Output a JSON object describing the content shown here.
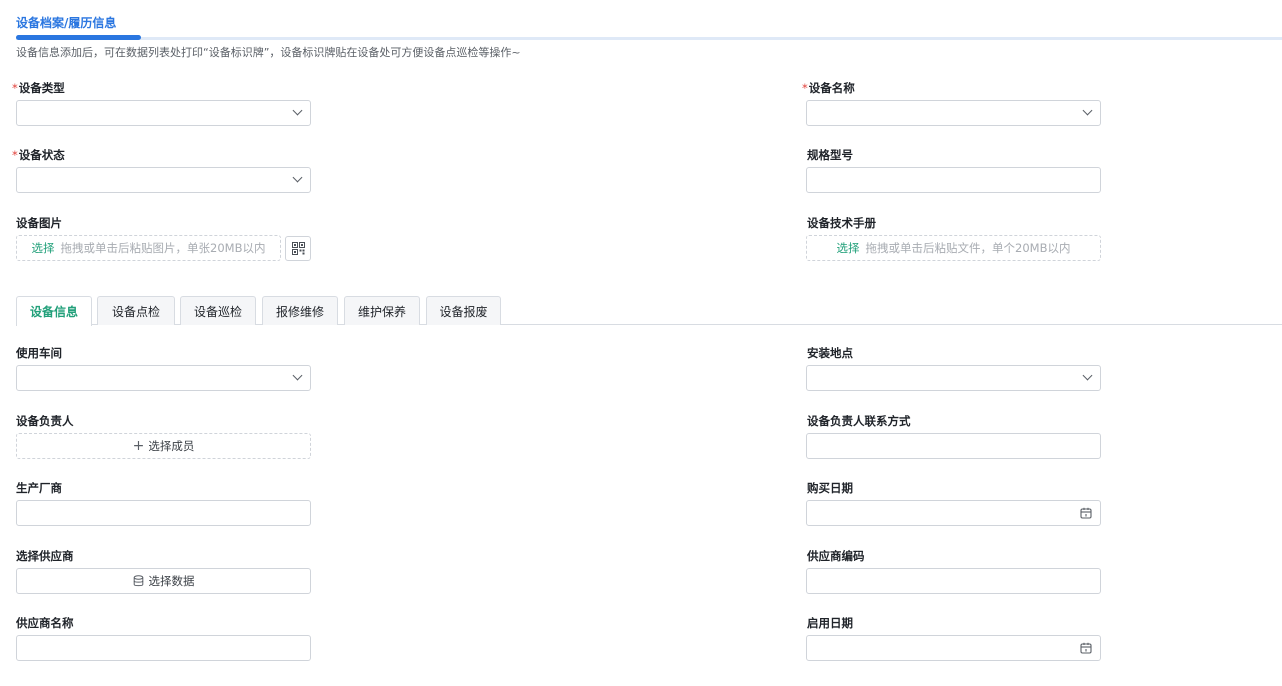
{
  "header": {
    "title": "设备档案/履历信息",
    "tip": "设备信息添加后，可在数据列表处打印“设备标识牌”，设备标识牌贴在设备处可方便设备点巡检等操作~"
  },
  "form": {
    "device_type": {
      "label": "设备类型",
      "required": "*"
    },
    "device_name": {
      "label": "设备名称",
      "required": "*"
    },
    "device_status": {
      "label": "设备状态",
      "required": "*"
    },
    "spec_model": {
      "label": "规格型号"
    },
    "device_image": {
      "label": "设备图片",
      "pick": "选择",
      "hint": "拖拽或单击后粘贴图片，单张20MB以内"
    },
    "tech_manual": {
      "label": "设备技术手册",
      "pick": "选择",
      "hint": "拖拽或单击后粘贴文件，单个20MB以内"
    }
  },
  "tabs": [
    "设备信息",
    "设备点检",
    "设备巡检",
    "报修维修",
    "维护保养",
    "设备报废"
  ],
  "info": {
    "workshop": {
      "label": "使用车间"
    },
    "location": {
      "label": "安装地点"
    },
    "owner": {
      "label": "设备负责人",
      "button": "选择成员"
    },
    "owner_contact": {
      "label": "设备负责人联系方式"
    },
    "manufacturer": {
      "label": "生产厂商"
    },
    "purchase_date": {
      "label": "购买日期"
    },
    "supplier": {
      "label": "选择供应商",
      "button": "选择数据"
    },
    "supplier_code": {
      "label": "供应商编码"
    },
    "supplier_name": {
      "label": "供应商名称"
    },
    "enable_date": {
      "label": "启用日期"
    }
  }
}
